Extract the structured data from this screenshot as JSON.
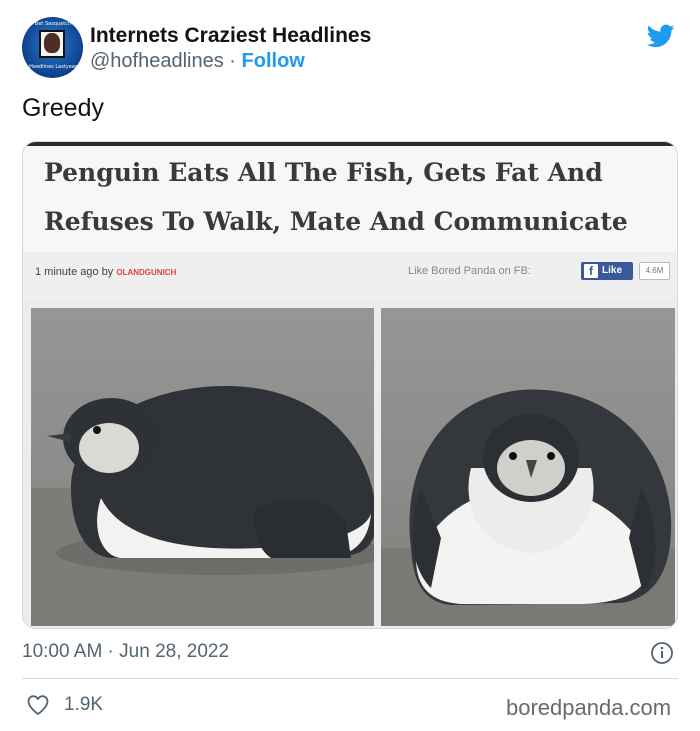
{
  "account": {
    "display_name": "Internets Craziest Headlines",
    "handle": "@hofheadlines",
    "separator": "·",
    "follow_label": "Follow",
    "avatar_text_top": "Bet Sasquatch",
    "avatar_text_bottom": "Headlines Lastyear"
  },
  "tweet": {
    "text": "Greedy",
    "timestamp": "10:00 AM · Jun 28, 2022",
    "likes": "1.9K"
  },
  "media": {
    "headline_line1": "Penguin Eats All The Fish, Gets Fat And",
    "headline_line2": "Refuses To Walk, Mate And Communicate",
    "meta_time": "1 minute ago by",
    "meta_author": "OLANDGUNICH",
    "fb_prompt": "Like Bored Panda on FB:",
    "fb_like_label": "Like",
    "fb_count": "4.6M"
  },
  "footer": {
    "watermark": "boredpanda.com"
  },
  "icons": {
    "brand": "twitter-bird-icon",
    "info": "info-icon",
    "like": "heart-icon",
    "facebook": "facebook-f-icon"
  },
  "colors": {
    "twitter_blue": "#1d9bf0",
    "facebook_blue": "#3b5998",
    "muted_text": "#536471"
  }
}
